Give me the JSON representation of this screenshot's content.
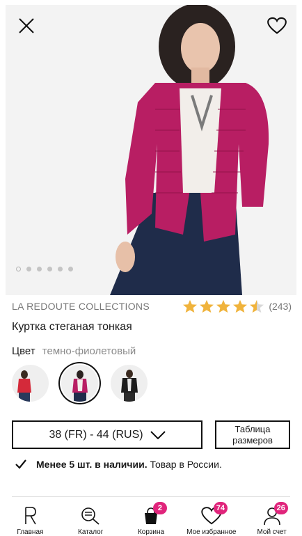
{
  "product": {
    "brand": "LA REDOUTE COLLECTIONS",
    "rating": 4.5,
    "review_count": "(243)",
    "title": "Куртка стеганая тонкая",
    "color_label": "Цвет",
    "color_value": "темно-фиолетовый",
    "swatches": [
      {
        "name": "red",
        "color": "#d42a3a"
      },
      {
        "name": "dark-violet",
        "color": "#b81e63",
        "selected": true
      },
      {
        "name": "black",
        "color": "#1c1c1c"
      }
    ],
    "size_value": "38 (FR) - 44 (RUS)",
    "size_table_label": "Таблица размеров",
    "stock_bold": "Менее 5 шт. в наличии.",
    "stock_rest": "Товар в России.",
    "image_dots": 6,
    "active_dot": 0
  },
  "tabs": [
    {
      "label": "Главная",
      "icon": "logo-r-icon"
    },
    {
      "label": "Каталог",
      "icon": "catalog-search-icon"
    },
    {
      "label": "Корзина",
      "icon": "shopping-bag-icon",
      "badge": "2"
    },
    {
      "label": "Мое избранное",
      "icon": "heart-icon",
      "badge": "74"
    },
    {
      "label": "Мой счет",
      "icon": "user-icon",
      "badge": "26"
    }
  ],
  "colors": {
    "accent": "#e0247b",
    "star": "#f0b33c",
    "jacket": "#b81e63"
  }
}
